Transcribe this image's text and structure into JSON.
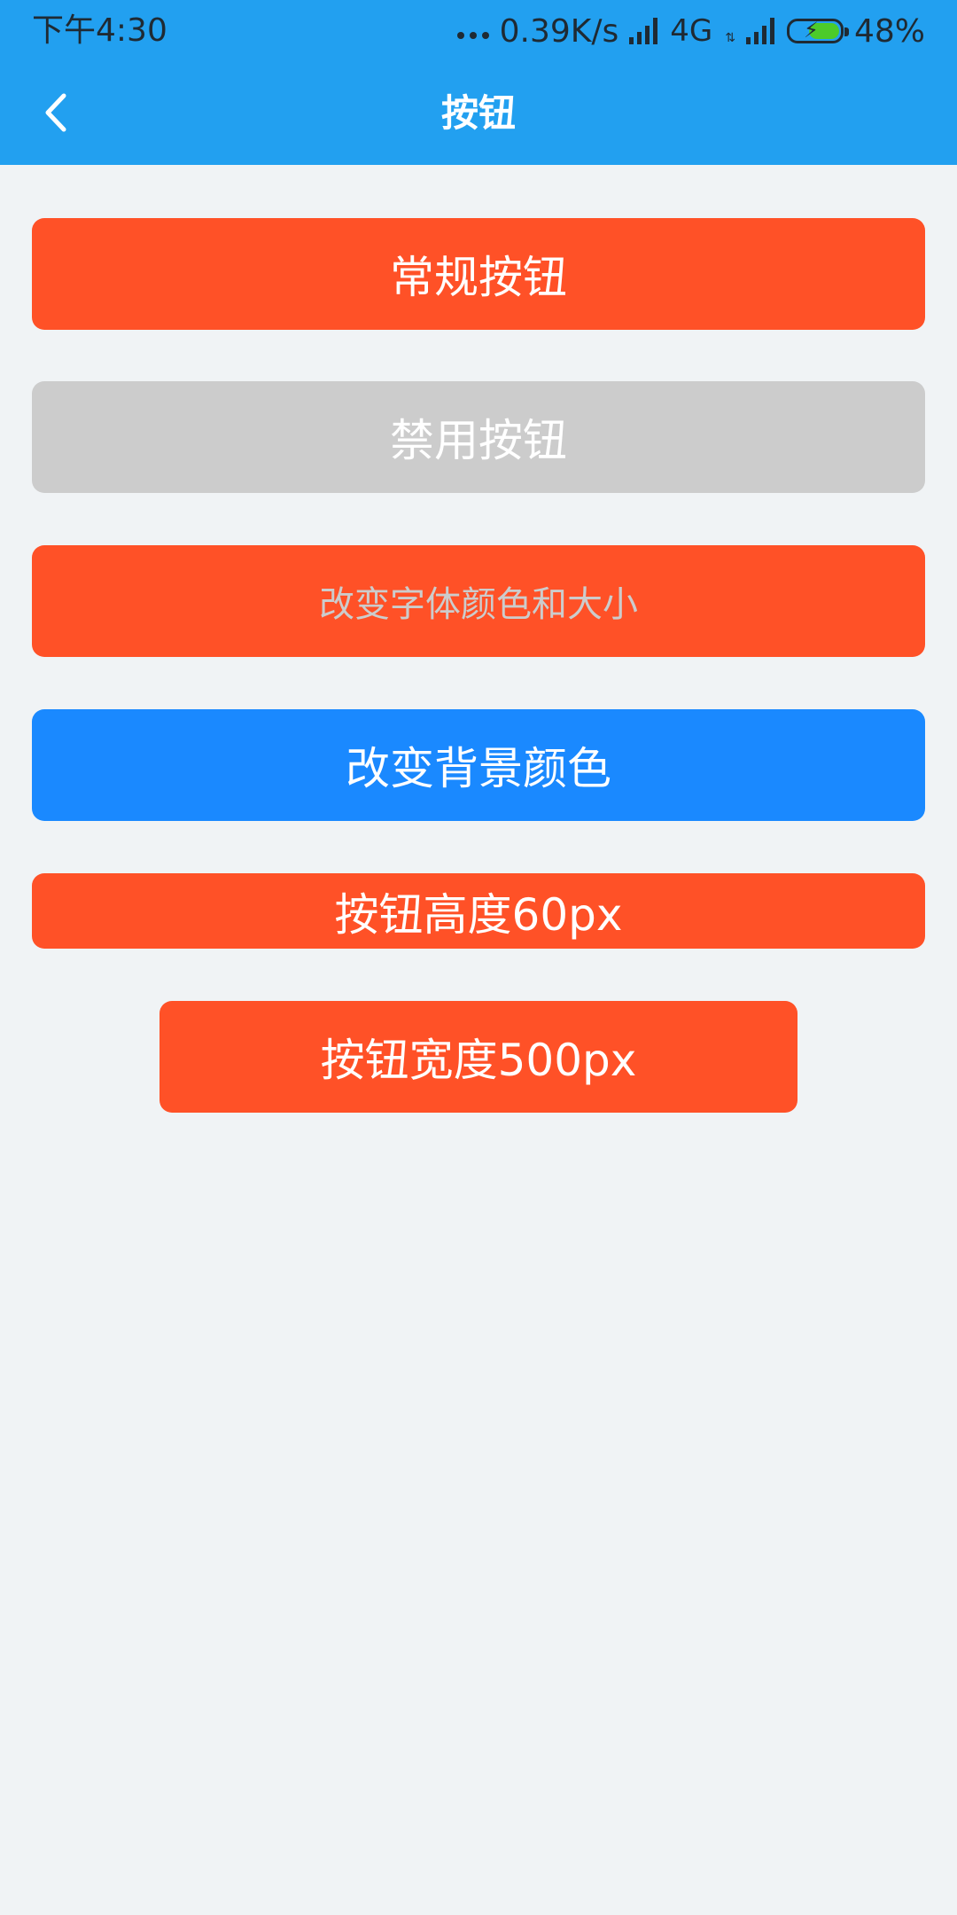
{
  "status_bar": {
    "time": "下午4:30",
    "network_speed": "0.39K/s",
    "network_type": "4G",
    "network_arrows": "⇅",
    "battery_percent": "48%",
    "icons": [
      "more-dots-icon",
      "signal-icon",
      "signal-icon",
      "battery-charging-icon"
    ]
  },
  "navbar": {
    "title": "按钮",
    "back_icon": "chevron-left-icon",
    "background_color": "#22a0f0"
  },
  "buttons": {
    "normal": {
      "label": "常规按钮",
      "color": "#ff5127"
    },
    "disabled": {
      "label": "禁用按钮",
      "color": "#cccccc"
    },
    "font_color": {
      "label": "改变字体颜色和大小",
      "color": "#ff5127",
      "text_color": "#cccccc"
    },
    "bg_color": {
      "label": "改变背景颜色",
      "color": "#1a89ff"
    },
    "height": {
      "label": "按钮高度60px",
      "color": "#ff5127"
    },
    "width": {
      "label": "按钮宽度500px",
      "color": "#ff5127"
    }
  },
  "page_background": "#f0f3f5"
}
